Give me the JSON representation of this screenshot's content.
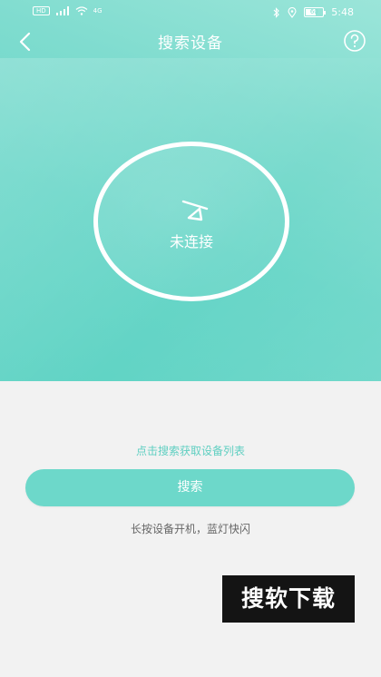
{
  "status_bar": {
    "left_badge": "HD",
    "signal_badge": "4G",
    "battery": "60",
    "battery_level": 0.6,
    "time": "5:48"
  },
  "nav": {
    "title": "搜索设备",
    "back_icon": "chevron-left-icon",
    "help_icon": "question-circle-icon"
  },
  "device": {
    "status_label": "未连接",
    "status_icon": "disconnected-icon"
  },
  "hint_text": "点击搜索获取设备列表",
  "search_button_label": "搜索",
  "tip_text": "长按设备开机，蓝灯快闪",
  "watermark_text": "搜软下载",
  "colors": {
    "accent": "#6dd8ca",
    "hint": "#5fcfc1",
    "background": "#f2f2f2"
  }
}
